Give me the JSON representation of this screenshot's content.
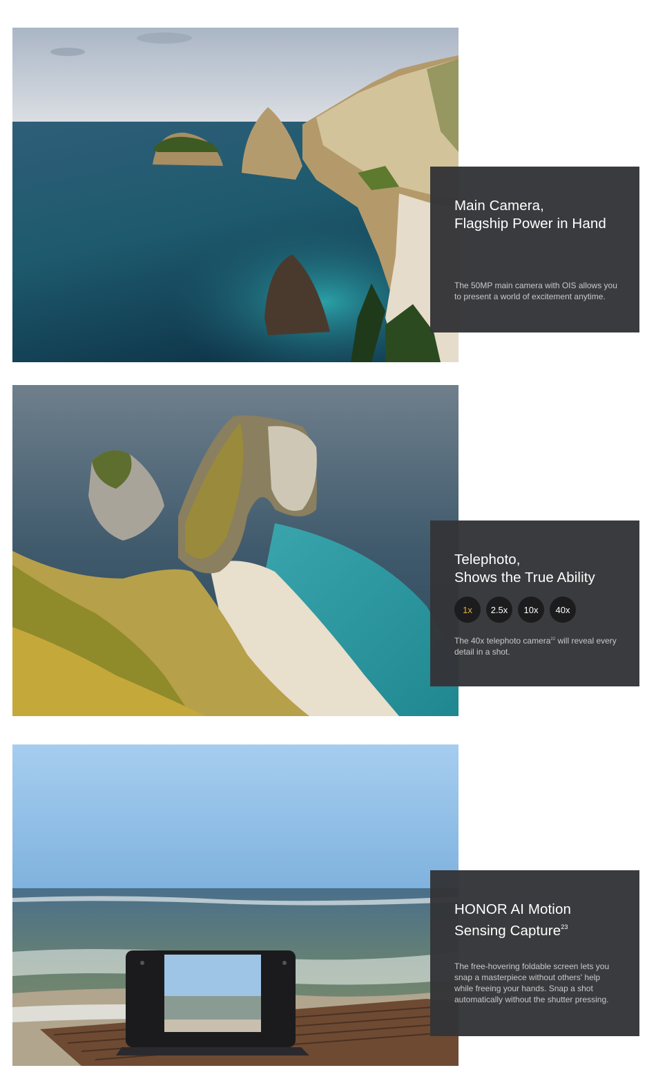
{
  "sections": [
    {
      "title_line1": "Main Camera,",
      "title_line2": "Flagship Power in Hand",
      "description": "The 50MP main camera with OIS allows you to present a world of excitement anytime.",
      "photo_alt": "coastal cliffs and sea stacks"
    },
    {
      "title_line1": "Telephoto,",
      "title_line2": "Shows the True Ability",
      "zoom_options": [
        "1x",
        "2.5x",
        "10x",
        "40x"
      ],
      "active_zoom": "1x",
      "description_before": "The 40x telephoto camera",
      "description_sup": "22",
      "description_after": " will reveal every detail in a shot.",
      "photo_alt": "headland and beach aerial view"
    },
    {
      "title_line1": "HONOR AI Motion",
      "title_line2": "Sensing Capture",
      "title_sup": "23",
      "description": "The free-hovering foldable screen lets you snap a masterpiece without others' help while freeing your hands. Snap a shot automatically without the shutter pressing.",
      "photo_alt": "foldable phone on a wooden table by the sea"
    }
  ],
  "colors": {
    "card_background": "#343538",
    "active_zoom": "#e3b23c",
    "zoom_button": "#1c1c1e"
  }
}
